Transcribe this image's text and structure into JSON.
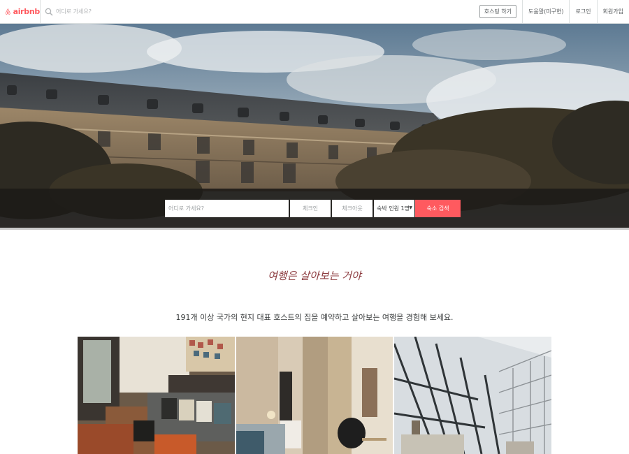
{
  "header": {
    "logo_text": "airbnb",
    "search_placeholder": "어디로 가세요?",
    "host_button": "호스팅 하기",
    "nav": [
      "도움말(미구현)",
      "로그인",
      "회원가입"
    ]
  },
  "hero": {
    "search": {
      "where_placeholder": "어디로 가세요?",
      "checkin_placeholder": "체크인",
      "checkout_placeholder": "체크아웃",
      "guests_value": "숙박 인원 1명",
      "search_button": "숙소 검색"
    }
  },
  "main": {
    "tagline": "여행은 살아보는 거야",
    "description": "191개 이상 국가의 현지 대표 호스트의 집을 예약하고 살아보는 여행을 경험해 보세요."
  },
  "colors": {
    "brand": "#ff5a5f",
    "tagline": "#8c3b3f"
  }
}
